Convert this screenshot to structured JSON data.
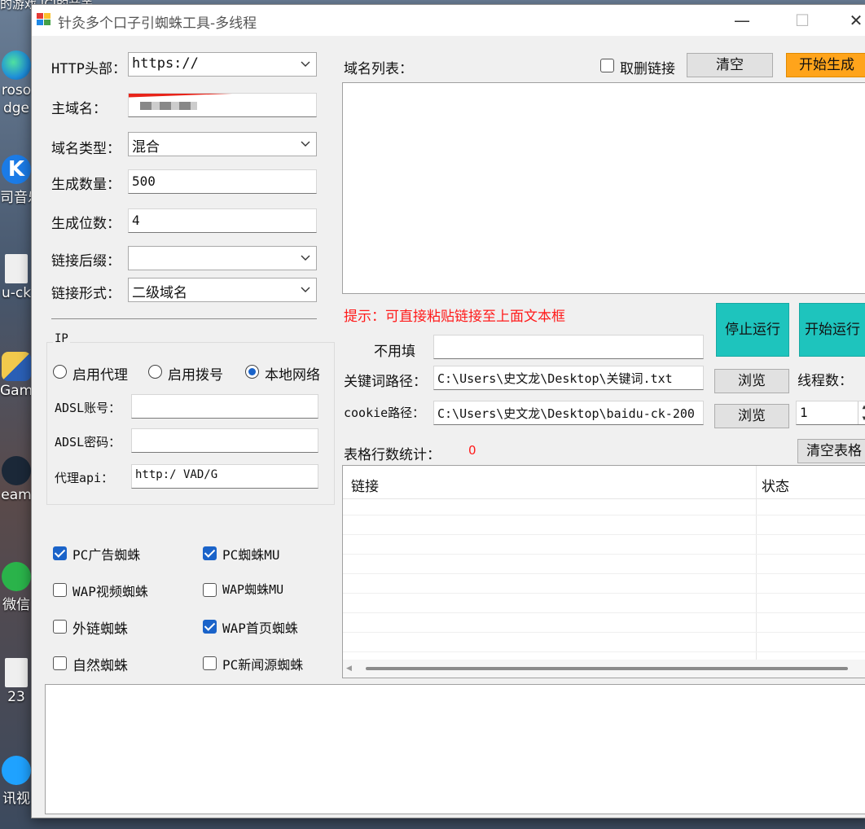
{
  "desktop": {
    "top_text": "的游戏   ICI的音关",
    "icons": [
      {
        "name": "edge",
        "label": "roso\ndge",
        "color": "#1f8fd8"
      },
      {
        "name": "kugou",
        "label": "司音乐",
        "color": "#1b7be6"
      },
      {
        "name": "file",
        "label": "u-ck",
        "color": "#e8e8e8"
      },
      {
        "name": "game",
        "label": "Gam",
        "color": "#2a5fb5"
      },
      {
        "name": "steam",
        "label": "eam",
        "color": "#1b2838"
      },
      {
        "name": "wechat",
        "label": "微信",
        "color": "#2ab34a"
      },
      {
        "name": "file2",
        "label": "23",
        "color": "#e8e8e8"
      },
      {
        "name": "video",
        "label": "讯视",
        "color": "#1fa2ff"
      }
    ]
  },
  "window": {
    "title": "针灸多个口子引蜘蛛工具-多线程",
    "minimize": "—",
    "maximize": "☐",
    "close": "✕"
  },
  "form": {
    "http_label": "HTTP头部：",
    "http_value": "https://",
    "domain_label": "主域名：",
    "domain_type_label": "域名类型：",
    "domain_type_value": "混合",
    "gen_count_label": "生成数量：",
    "gen_count_value": "500",
    "gen_digits_label": "生成位数：",
    "gen_digits_value": "4",
    "suffix_label": "链接后缀：",
    "suffix_value": "",
    "link_form_label": "链接形式：",
    "link_form_value": "二级域名"
  },
  "ip_group": {
    "legend": "IP",
    "proxy_label": "启用代理",
    "dialup_label": "启用拨号",
    "local_label": "本地网络",
    "adsl_user_label": "ADSL账号：",
    "adsl_pass_label": "ADSL密码：",
    "proxy_api_label": "代理api：",
    "proxy_api_value": "http:/  VAD/G"
  },
  "spiders": [
    {
      "label": "PC广告蜘蛛",
      "checked": true
    },
    {
      "label": "PC蜘蛛MU",
      "checked": true
    },
    {
      "label": "WAP视频蜘蛛",
      "checked": false
    },
    {
      "label": "WAP蜘蛛MU",
      "checked": false
    },
    {
      "label": "外链蜘蛛",
      "checked": false
    },
    {
      "label": "WAP首页蜘蛛",
      "checked": true
    },
    {
      "label": "自然蜘蛛",
      "checked": false
    },
    {
      "label": "PC新闻源蜘蛛",
      "checked": false
    }
  ],
  "domain_list": {
    "label": "域名列表：",
    "dedupe_label": "取删链接",
    "clear_button": "清空",
    "start_gen_button": "开始生成"
  },
  "hint": "提示：可直接粘贴链接至上面文本框",
  "paths": {
    "unused_label": "不用填",
    "keyword_label": "关键词路径：",
    "keyword_value": "C:\\Users\\史文龙\\Desktop\\关键词.txt",
    "cookie_label": "cookie路径：",
    "cookie_value": "C:\\Users\\史文龙\\Desktop\\baidu-ck-200",
    "browse_button": "浏览"
  },
  "run": {
    "stop_button": "停止运行",
    "start_button": "开始运行",
    "threads_label": "线程数：",
    "threads_value": "1"
  },
  "table": {
    "row_count_label": "表格行数统计：",
    "row_count_value": "0",
    "clear_table_button": "清空表格",
    "col_link": "链接",
    "col_status": "状态"
  },
  "colors": {
    "accent_orange": "#ffa41b",
    "teal_button": "#1ec4bd",
    "hint_red": "#ff1a1a",
    "check_blue": "#1a63c9"
  }
}
